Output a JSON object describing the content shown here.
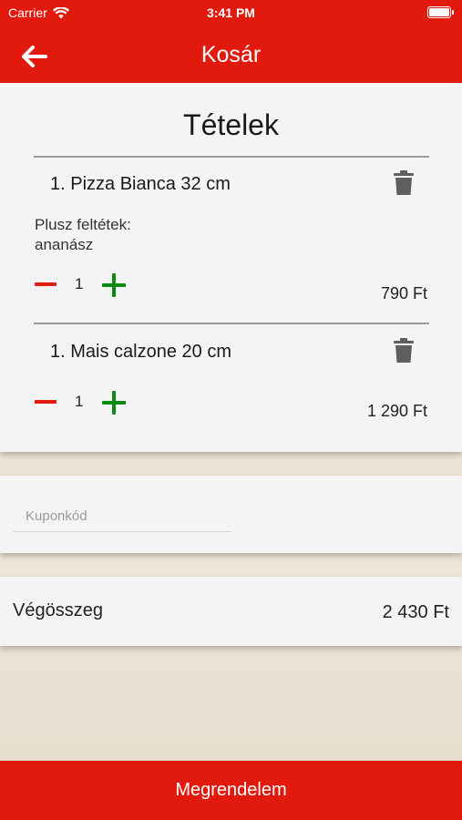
{
  "status_bar": {
    "carrier": "Carrier",
    "time": "3:41 PM"
  },
  "nav": {
    "title": "Kosár",
    "back_icon": "arrow-left-icon"
  },
  "items_section": {
    "heading": "Tételek",
    "items": [
      {
        "title": "1. Pizza Bianca 32 cm",
        "extras_label": "Plusz feltétek:",
        "extras_value": "ananász",
        "quantity": "1",
        "price": "790 Ft"
      },
      {
        "title": "1. Mais calzone 20 cm",
        "quantity": "1",
        "price": "1 290 Ft"
      }
    ]
  },
  "coupon": {
    "placeholder": "Kuponkód",
    "value": ""
  },
  "total": {
    "label": "Végösszeg",
    "value": "2 430 Ft"
  },
  "order_button": {
    "label": "Megrendelem"
  },
  "colors": {
    "brand_red": "#e21a0e",
    "plus_green": "#0c8a13",
    "card_bg": "#f4f4f4"
  }
}
